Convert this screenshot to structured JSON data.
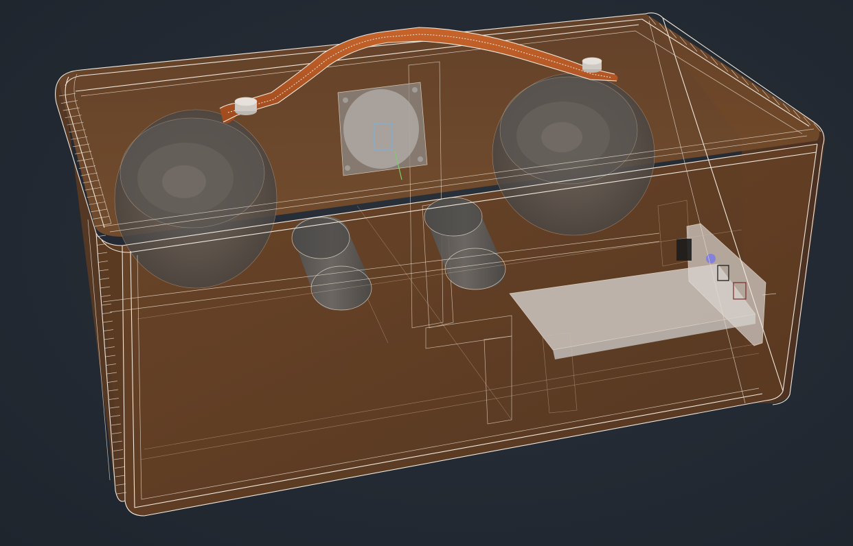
{
  "viewport": {
    "background": "#242a33",
    "style": "x-ray wireframe",
    "accent_wire": "#f2eadf"
  },
  "model": {
    "object": "speaker-box",
    "body_color": "#6b4326",
    "body_color_dark": "#563620",
    "handle_color": "#b85a26",
    "driver_color": "#5f5a55",
    "board_color": "#c9c3bd",
    "parts": [
      {
        "name": "cabinet",
        "icon": "box-icon"
      },
      {
        "name": "carry-handle",
        "icon": "handle-icon"
      },
      {
        "name": "left-woofer",
        "icon": "speaker-icon"
      },
      {
        "name": "right-woofer",
        "icon": "speaker-icon"
      },
      {
        "name": "center-tweeter",
        "icon": "speaker-icon"
      },
      {
        "name": "left-bass-port",
        "icon": "tube-icon"
      },
      {
        "name": "right-bass-port",
        "icon": "tube-icon"
      },
      {
        "name": "center-divider",
        "icon": "panel-icon"
      },
      {
        "name": "amplifier-board",
        "icon": "circuit-board-icon"
      },
      {
        "name": "rear-connector-panel",
        "icon": "connector-icon"
      }
    ]
  }
}
